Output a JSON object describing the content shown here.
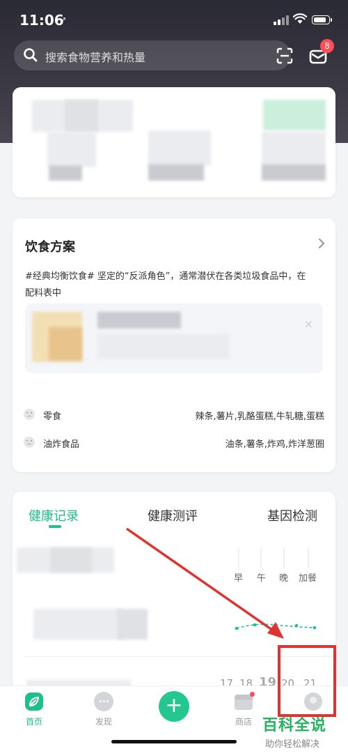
{
  "status_bar": {
    "time": "11:06",
    "location_icon": "location-arrow-icon"
  },
  "search": {
    "placeholder": "搜索食物营养和热量",
    "scan_icon": "scan-icon"
  },
  "messages": {
    "badge_count": "8"
  },
  "diet_plan": {
    "title": "饮食方案",
    "description_line1": "#经典均衡饮食# 坚定的“反派角色”，通常潜伏在各类垃圾食品中，在",
    "description_line2": "配料表中",
    "rows": [
      {
        "name": "零食",
        "items": "辣条,薯片,乳酪蛋糕,牛轧糖,蛋糕"
      },
      {
        "name": "油炸食品",
        "items": "油条,薯条,炸鸡,炸洋葱圈"
      }
    ]
  },
  "health": {
    "tabs": [
      "健康记录",
      "健康测评",
      "基因检测"
    ],
    "active_tab": 0,
    "meals": [
      "早",
      "午",
      "晚",
      "加餐"
    ],
    "dates": [
      "17",
      "18",
      "19",
      "20",
      "21"
    ]
  },
  "bottom_nav": {
    "items": [
      {
        "label": "首页",
        "icon": "leaf-home-icon",
        "active": true
      },
      {
        "label": "发现",
        "icon": "chat-bubble-icon",
        "active": false
      },
      {
        "label": "",
        "icon": "plus-icon",
        "active": false
      },
      {
        "label": "商店",
        "icon": "store-icon",
        "active": false
      },
      {
        "label": "",
        "icon": "profile-icon",
        "active": false
      }
    ]
  },
  "watermark": {
    "title": "百科全说",
    "subtitle": "助你轻松解决"
  },
  "colors": {
    "accent": "#1dbf8a",
    "badge": "#ff4d5a",
    "annotation": "#e0322f"
  }
}
